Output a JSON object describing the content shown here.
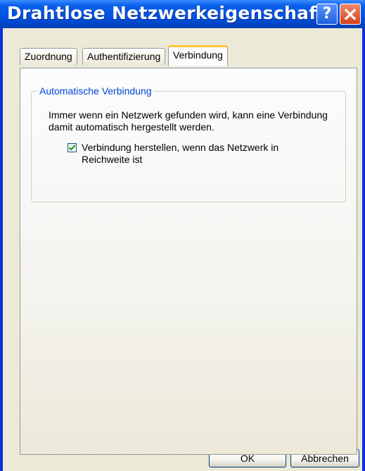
{
  "window": {
    "title": "Drahtlose Netzwerkeigenschaf...",
    "help_label": "?",
    "close_label": "×"
  },
  "tabs": [
    {
      "label": "Zuordnung",
      "active": false
    },
    {
      "label": "Authentifizierung",
      "active": false
    },
    {
      "label": "Verbindung",
      "active": true
    }
  ],
  "group": {
    "title": "Automatische Verbindung",
    "description": "Immer wenn ein Netzwerk gefunden wird, kann eine Verbindung damit automatisch hergestellt werden.",
    "checkbox": {
      "label": "Verbindung herstellen, wenn das Netzwerk in Reichweite ist",
      "checked": true
    }
  },
  "buttons": {
    "ok": "OK",
    "cancel": "Abbrechen"
  },
  "colors": {
    "titlebar": "#0054e3",
    "group_title": "#0046d5",
    "active_tab_accent": "#ffc83c",
    "check_mark": "#21a121"
  }
}
